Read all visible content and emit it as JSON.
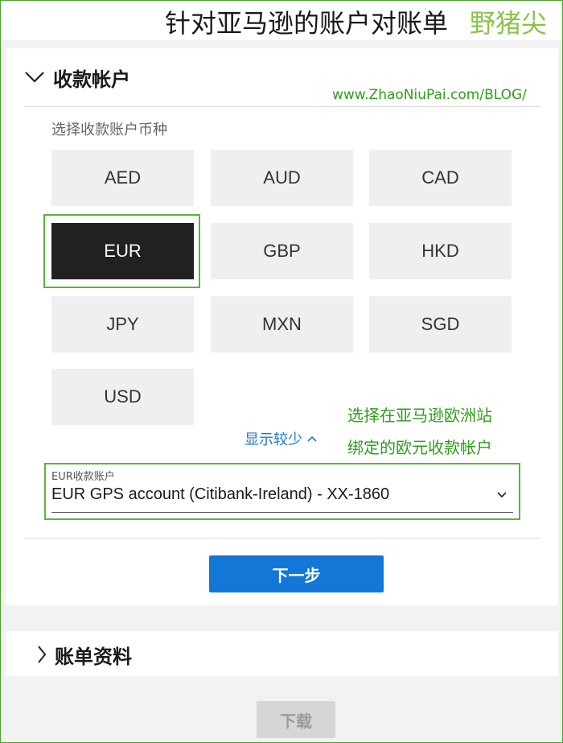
{
  "header": {
    "title": "针对亚马逊的账户对账单",
    "brand": "野猪尖"
  },
  "watermark_url": "www.ZhaoNiuPai.com/BLOG/",
  "receiving_account": {
    "section_title": "收款帐户",
    "pick_currency_label": "选择收款账户币种",
    "currencies": [
      "AED",
      "AUD",
      "CAD",
      "EUR",
      "GBP",
      "HKD",
      "JPY",
      "MXN",
      "SGD",
      "USD"
    ],
    "selected_currency": "EUR",
    "show_less_label": "显示较少",
    "account_select": {
      "label": "EUR收款账户",
      "value": "EUR GPS account (Citibank-Ireland) - XX-1860"
    },
    "next_button": "下一步"
  },
  "annotation": {
    "line1": "选择在亚马逊欧洲站",
    "line2": "绑定的欧元收款帐户"
  },
  "billing_info": {
    "section_title": "账单资料"
  },
  "download_button": "下载",
  "colors": {
    "accent_blue": "#1377d8",
    "annotation_green": "#2e9e1b",
    "selected_dark": "#212121"
  }
}
